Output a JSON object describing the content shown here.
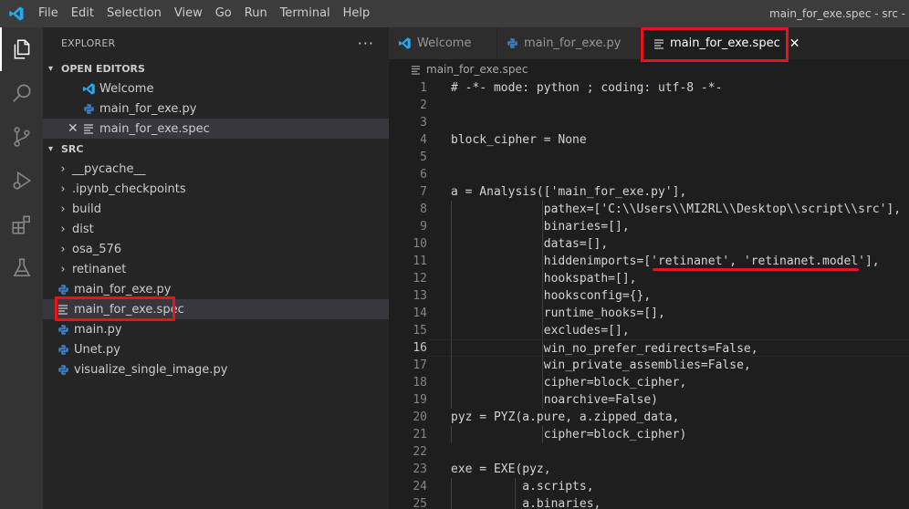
{
  "menu": [
    "File",
    "Edit",
    "Selection",
    "View",
    "Go",
    "Run",
    "Terminal",
    "Help"
  ],
  "window_title": "main_for_exe.spec - src - Visual Studio Code",
  "activity_icons": [
    "explorer-icon",
    "search-icon",
    "source-control-icon",
    "run-debug-icon",
    "extensions-icon",
    "testing-icon"
  ],
  "explorer": {
    "title": "EXPLORER",
    "more": "···",
    "open_editors": {
      "title": "OPEN EDITORS",
      "items": [
        {
          "name": "Welcome",
          "icon": "vscode-icon"
        },
        {
          "name": "main_for_exe.py",
          "icon": "python-icon"
        },
        {
          "name": "main_for_exe.spec",
          "icon": "file-lines-icon",
          "close": "✕"
        }
      ]
    },
    "folder": {
      "title": "SRC",
      "items": [
        {
          "name": "__pycache__",
          "type": "folder"
        },
        {
          "name": ".ipynb_checkpoints",
          "type": "folder"
        },
        {
          "name": "build",
          "type": "folder"
        },
        {
          "name": "dist",
          "type": "folder"
        },
        {
          "name": "osa_576",
          "type": "folder"
        },
        {
          "name": "retinanet",
          "type": "folder"
        },
        {
          "name": "main_for_exe.py",
          "type": "python"
        },
        {
          "name": "main_for_exe.spec",
          "type": "spec"
        },
        {
          "name": "main.py",
          "type": "python"
        },
        {
          "name": "Unet.py",
          "type": "python"
        },
        {
          "name": "visualize_single_image.py",
          "type": "python"
        }
      ]
    }
  },
  "tabs": [
    {
      "label": "Welcome",
      "icon": "vscode-icon"
    },
    {
      "label": "main_for_exe.py",
      "icon": "python-icon"
    },
    {
      "label": "main_for_exe.spec",
      "icon": "file-lines-icon",
      "close": "✕"
    }
  ],
  "breadcrumb": "main_for_exe.spec",
  "code_lines": [
    {
      "n": "1",
      "text": "# -*- mode: python ; coding: utf-8 -*-"
    },
    {
      "n": "2",
      "text": ""
    },
    {
      "n": "3",
      "text": ""
    },
    {
      "n": "4",
      "text": "block_cipher = None"
    },
    {
      "n": "5",
      "text": ""
    },
    {
      "n": "6",
      "text": ""
    },
    {
      "n": "7",
      "text": "a = Analysis(['main_for_exe.py'],"
    },
    {
      "n": "8",
      "text": "             pathex=['C:\\\\Users\\\\MI2RL\\\\Desktop\\\\script\\\\src'],"
    },
    {
      "n": "9",
      "text": "             binaries=[],"
    },
    {
      "n": "10",
      "text": "             datas=[],"
    },
    {
      "n": "11",
      "text": "             hiddenimports=['retinanet', 'retinanet.model'],"
    },
    {
      "n": "12",
      "text": "             hookspath=[],"
    },
    {
      "n": "13",
      "text": "             hooksconfig={},"
    },
    {
      "n": "14",
      "text": "             runtime_hooks=[],"
    },
    {
      "n": "15",
      "text": "             excludes=[],"
    },
    {
      "n": "16",
      "text": "             win_no_prefer_redirects=False,"
    },
    {
      "n": "17",
      "text": "             win_private_assemblies=False,"
    },
    {
      "n": "18",
      "text": "             cipher=block_cipher,"
    },
    {
      "n": "19",
      "text": "             noarchive=False)"
    },
    {
      "n": "20",
      "text": "pyz = PYZ(a.pure, a.zipped_data,"
    },
    {
      "n": "21",
      "text": "             cipher=block_cipher)"
    },
    {
      "n": "22",
      "text": ""
    },
    {
      "n": "23",
      "text": "exe = EXE(pyz,"
    },
    {
      "n": "24",
      "text": "          a.scripts,"
    },
    {
      "n": "25",
      "text": "          a.binaries,"
    }
  ],
  "current_line": "16",
  "colors": {
    "highlight": "#e8131d",
    "python_blue": "#3b7bbf",
    "vscode_blue": "#23a9f2"
  }
}
